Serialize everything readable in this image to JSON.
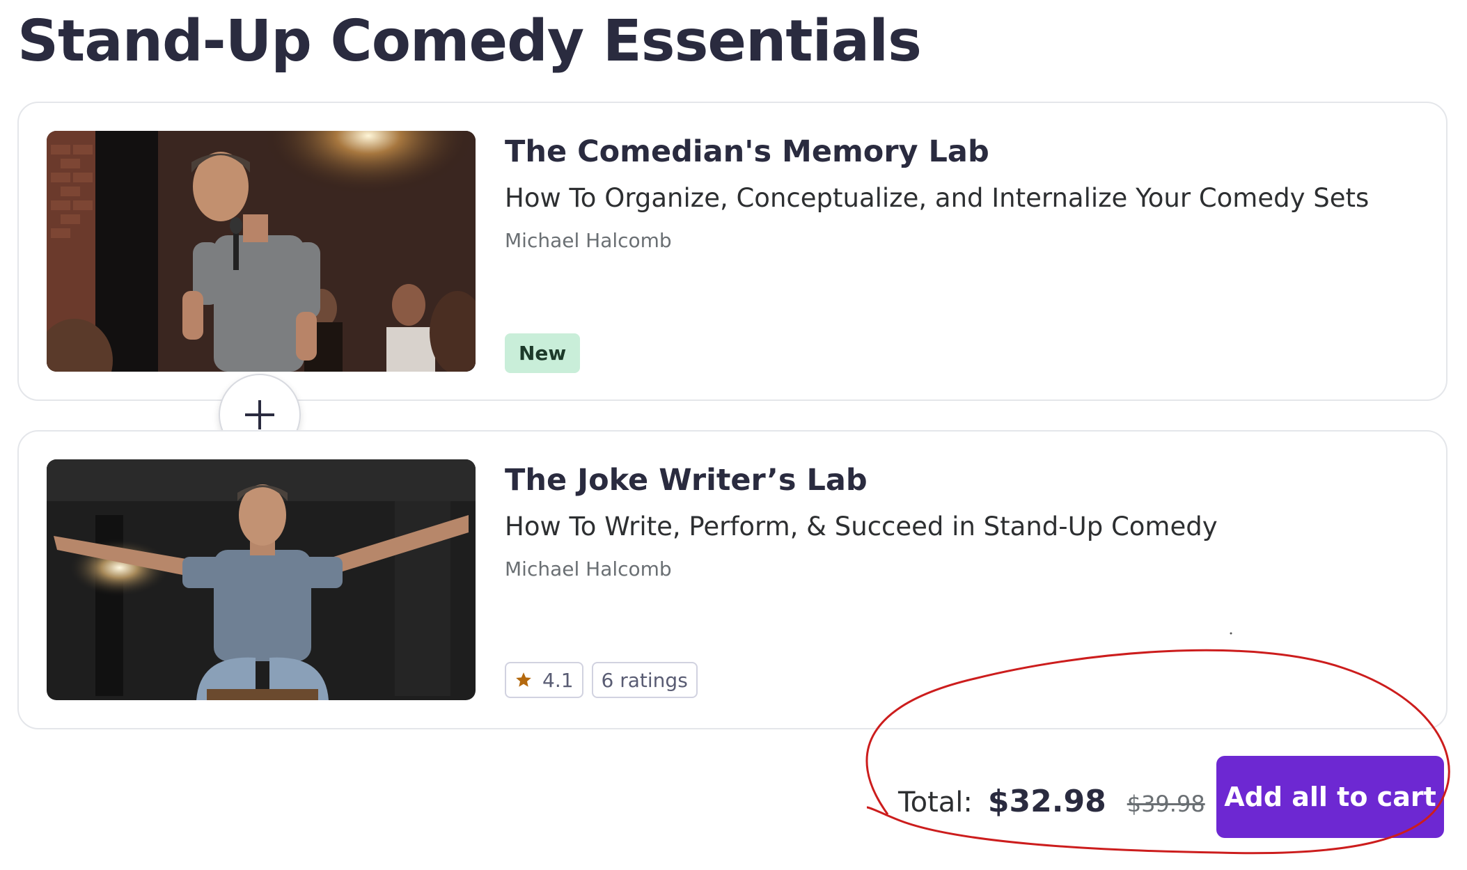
{
  "page_title": "Stand-Up Comedy Essentials",
  "courses": [
    {
      "title": "The Comedian's Memory Lab",
      "subtitle": "How To Organize, Conceptualize, and Internalize Your Comedy Sets",
      "author": "Michael Halcomb",
      "badge": "New"
    },
    {
      "title": "The Joke Writer’s Lab",
      "subtitle": "How To Write, Perform, & Succeed in Stand-Up Comedy",
      "author": "Michael Halcomb",
      "rating": "4.1",
      "ratings_count": "6 ratings"
    }
  ],
  "bundle": {
    "total_label": "Total:",
    "total_price": "$32.98",
    "original_price": "$39.98",
    "add_button_label": "Add all to cart"
  },
  "colors": {
    "accent": "#6d28d2",
    "badge_new_bg": "#c9eed9",
    "star": "#b4690e",
    "annotation": "#cc1d1d"
  },
  "icons": {
    "plus": "plus-icon",
    "star": "star-icon"
  }
}
